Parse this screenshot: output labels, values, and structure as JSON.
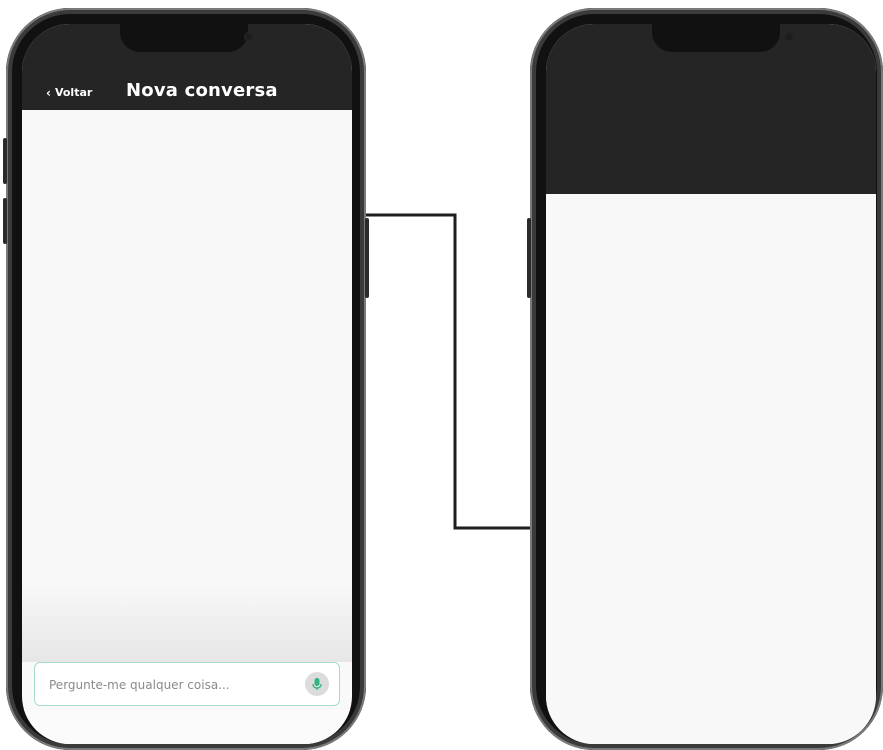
{
  "left_screen": {
    "header": {
      "back_label": "Voltar",
      "title": "Nova conversa"
    },
    "input": {
      "placeholder": "Pergunte-me qualquer coisa...",
      "value": ""
    },
    "mic_icon": "microphone-icon"
  },
  "right_screen": {
    "state": "loading"
  },
  "colors": {
    "header_bg": "#252525",
    "screen_bg": "#f8f8f9",
    "input_border": "#a8dcc4",
    "mic_accent": "#2fb67d",
    "connector": "#1e1e1e"
  }
}
